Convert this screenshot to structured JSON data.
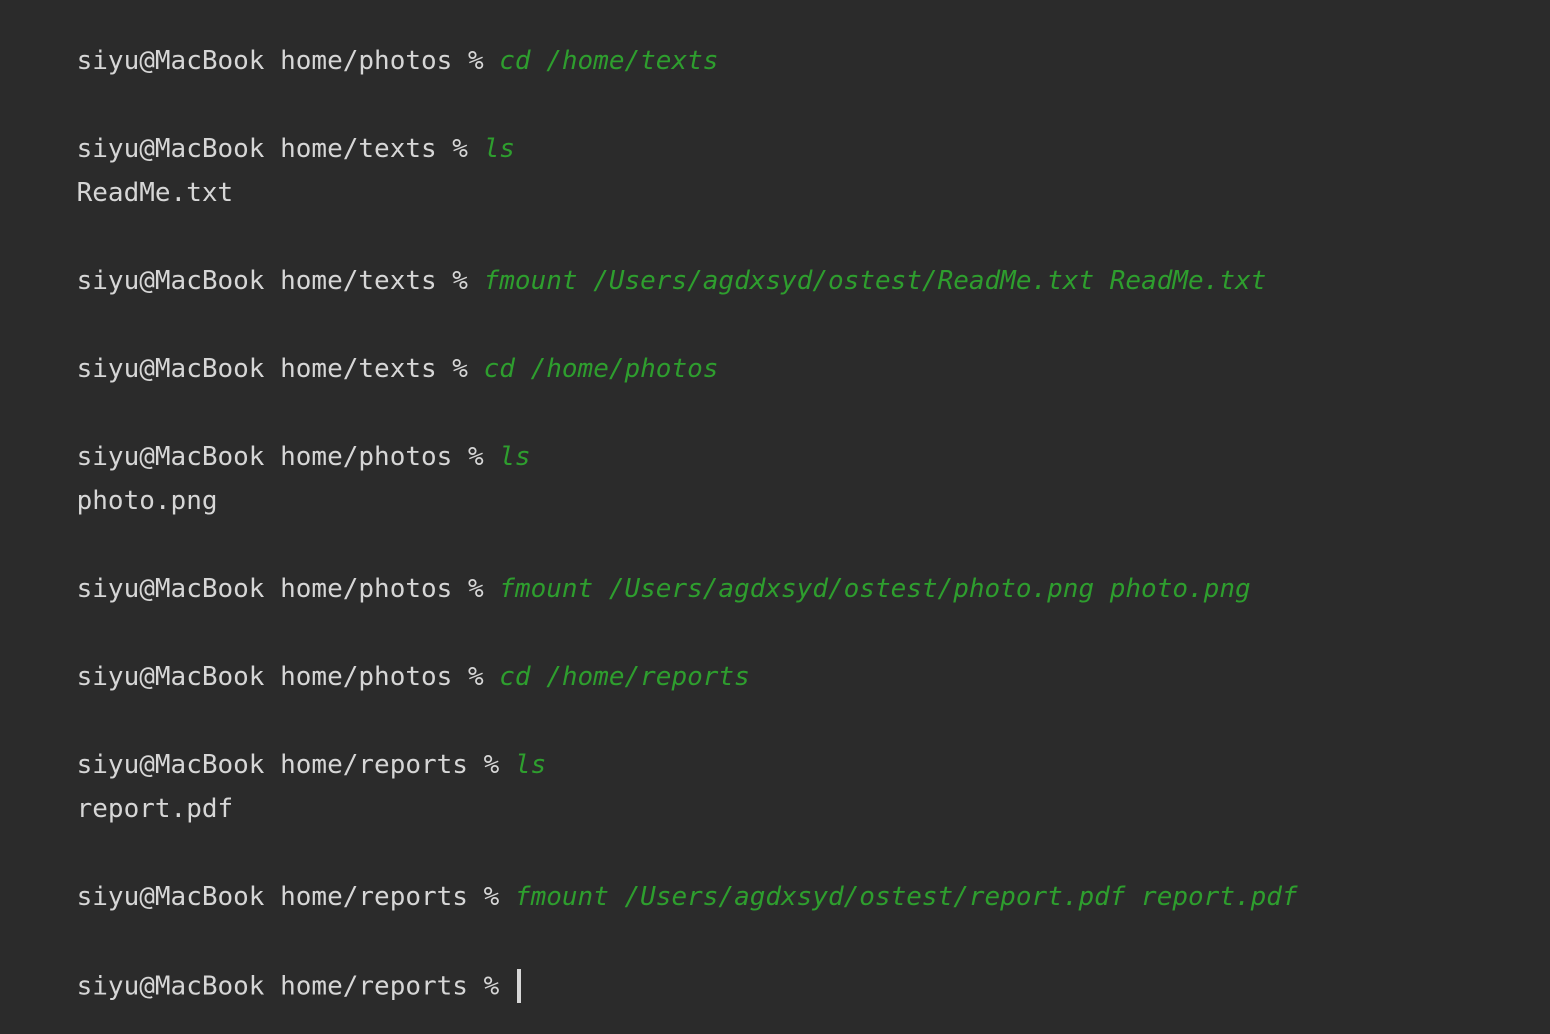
{
  "lines": [
    {
      "type": "prompt",
      "prompt": "siyu@MacBook home/photos % ",
      "command": "cd /home/texts"
    },
    {
      "type": "prompt",
      "prompt": "siyu@MacBook home/texts % ",
      "command": "ls"
    },
    {
      "type": "output",
      "text": "ReadMe.txt"
    },
    {
      "type": "prompt",
      "prompt": "siyu@MacBook home/texts % ",
      "command": "fmount /Users/agdxsyd/ostest/ReadMe.txt ReadMe.txt"
    },
    {
      "type": "prompt",
      "prompt": "siyu@MacBook home/texts % ",
      "command": "cd /home/photos"
    },
    {
      "type": "prompt",
      "prompt": "siyu@MacBook home/photos % ",
      "command": "ls"
    },
    {
      "type": "output",
      "text": "photo.png"
    },
    {
      "type": "prompt",
      "prompt": "siyu@MacBook home/photos % ",
      "command": "fmount /Users/agdxsyd/ostest/photo.png photo.png"
    },
    {
      "type": "prompt",
      "prompt": "siyu@MacBook home/photos % ",
      "command": "cd /home/reports"
    },
    {
      "type": "prompt",
      "prompt": "siyu@MacBook home/reports % ",
      "command": "ls"
    },
    {
      "type": "output",
      "text": "report.pdf"
    },
    {
      "type": "prompt",
      "prompt": "siyu@MacBook home/reports % ",
      "command": "fmount /Users/agdxsyd/ostest/report.pdf report.pdf"
    },
    {
      "type": "prompt",
      "prompt": "siyu@MacBook home/reports % ",
      "command": ""
    }
  ],
  "colors": {
    "background": "#2b2b2b",
    "text": "#d6d6d6",
    "command": "#2e9e2e"
  }
}
